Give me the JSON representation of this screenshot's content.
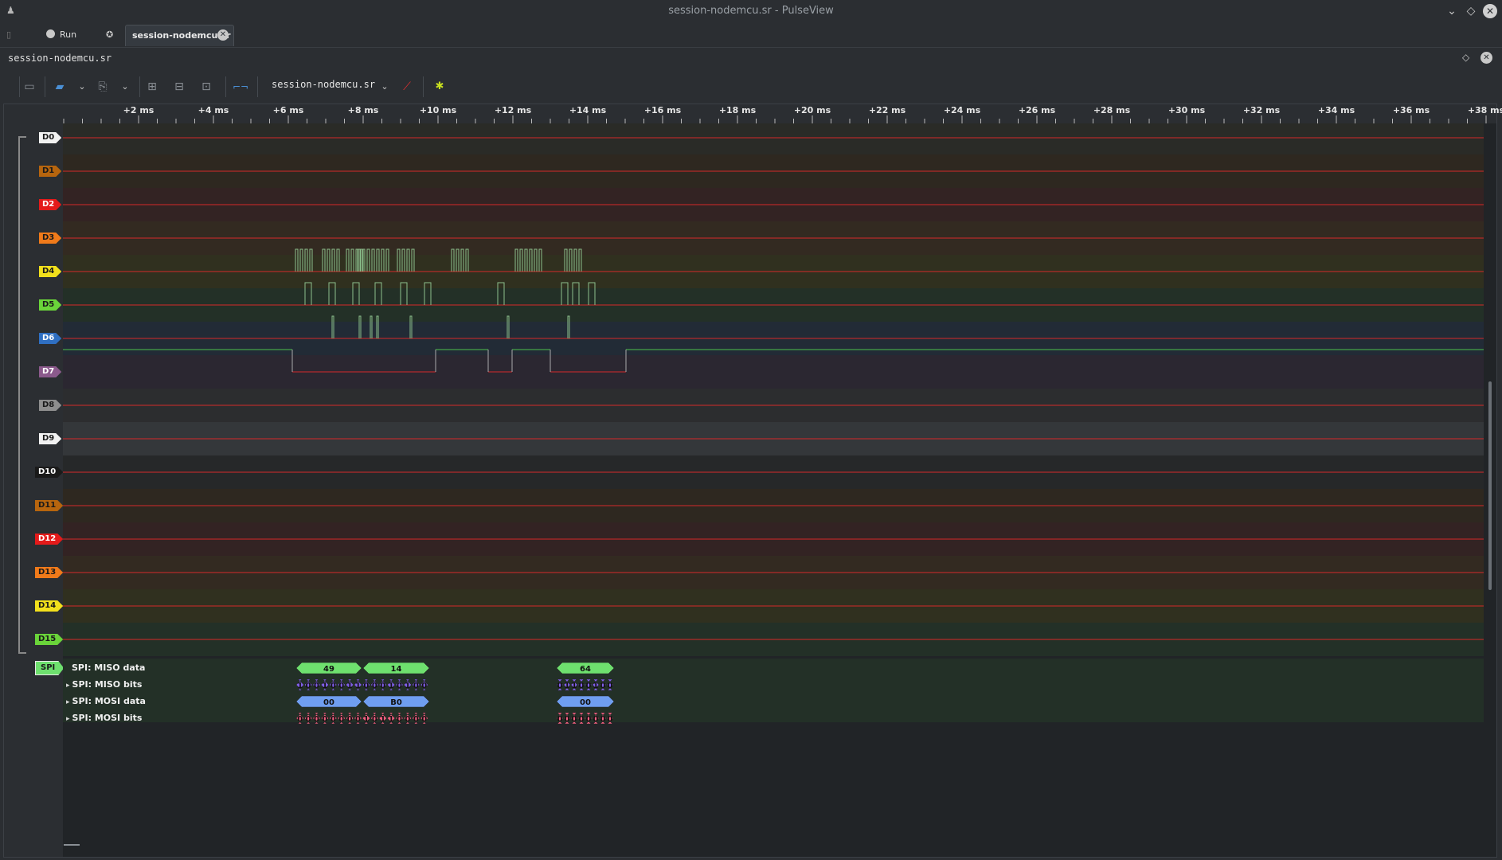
{
  "window": {
    "title": "session-nodemcu.sr - PulseView"
  },
  "tabbar": {
    "run_label": "Run",
    "tab_label": "session-nodemcu.sr"
  },
  "session": {
    "label": "session-nodemcu.sr"
  },
  "toolbar": {
    "device_label": "session-nodemcu.sr"
  },
  "ruler": {
    "ticks": [
      "+2 ms",
      "+4 ms",
      "+6 ms",
      "+8 ms",
      "+10 ms",
      "+12 ms",
      "+14 ms",
      "+16 ms",
      "+18 ms",
      "+20 ms",
      "+22 ms",
      "+24 ms",
      "+26 ms",
      "+28 ms",
      "+30 ms",
      "+32 ms",
      "+34 ms",
      "+36 ms",
      "+38 ms"
    ]
  },
  "channels": [
    {
      "name": "D0",
      "color": "#f2f2f2",
      "text": "#1a1a1a",
      "band": "#2a2b27"
    },
    {
      "name": "D1",
      "color": "#b7650e",
      "text": "#1a1a1a",
      "band": "#2e2820"
    },
    {
      "name": "D2",
      "color": "#e41a1a",
      "text": "#ffffff",
      "band": "#332323"
    },
    {
      "name": "D3",
      "color": "#f07a1a",
      "text": "#1a1a1a",
      "band": "#332a21"
    },
    {
      "name": "D4",
      "color": "#f2e01c",
      "text": "#1a1a1a",
      "band": "#30301f"
    },
    {
      "name": "D5",
      "color": "#6ad43a",
      "text": "#1a1a1a",
      "band": "#233027"
    },
    {
      "name": "D6",
      "color": "#2f6fc2",
      "text": "#ffffff",
      "band": "#222b36"
    },
    {
      "name": "D7",
      "color": "#8b5a8c",
      "text": "#ffffff",
      "band": "#2b2731"
    },
    {
      "name": "D8",
      "color": "#8e8e8e",
      "text": "#1a1a1a",
      "band": "#2c2d2f"
    },
    {
      "name": "D9",
      "color": "#f2f2f2",
      "text": "#1a1a1a",
      "band": "#34373a"
    },
    {
      "name": "D10",
      "color": "#1a1a1a",
      "text": "#ffffff",
      "band": "#262829"
    },
    {
      "name": "D11",
      "color": "#b7650e",
      "text": "#1a1a1a",
      "band": "#2e2820"
    },
    {
      "name": "D12",
      "color": "#e41a1a",
      "text": "#ffffff",
      "band": "#332323"
    },
    {
      "name": "D13",
      "color": "#f07a1a",
      "text": "#1a1a1a",
      "band": "#332a21"
    },
    {
      "name": "D14",
      "color": "#f2e01c",
      "text": "#1a1a1a",
      "band": "#30301f"
    },
    {
      "name": "D15",
      "color": "#6ad43a",
      "text": "#1a1a1a",
      "band": "#233027"
    }
  ],
  "decoder": {
    "badge": "SPI",
    "rows": [
      {
        "label": "SPI: MISO data",
        "expander": false,
        "color": "#6ee06e",
        "annotations": [
          {
            "text": "49",
            "start": 6.2,
            "end": 9.7
          },
          {
            "text": "14",
            "start": 9.8,
            "end": 13.4
          },
          {
            "text": "64",
            "start": 19.7,
            "end": 22.9
          }
        ]
      },
      {
        "label": "SPI: MISO bits",
        "expander": true,
        "color": "#8060e8",
        "bits": [
          "1",
          "0",
          "0",
          "1",
          "0",
          "0",
          "1",
          "1",
          "0",
          "0",
          "0",
          "1",
          "0",
          "1",
          "0",
          "0"
        ],
        "bits2": [
          "0",
          "1",
          "1",
          "0",
          "0",
          "1",
          "0",
          "0"
        ]
      },
      {
        "label": "SPI: MOSI data",
        "expander": true,
        "color": "#6f9ef0",
        "annotations": [
          {
            "text": "00",
            "start": 6.2,
            "end": 9.7
          },
          {
            "text": "B0",
            "start": 9.8,
            "end": 13.4
          },
          {
            "text": "00",
            "start": 19.7,
            "end": 22.9
          }
        ]
      },
      {
        "label": "SPI: MOSI bits",
        "expander": true,
        "color": "#f06080",
        "bits": [
          "0",
          "0",
          "0",
          "0",
          "0",
          "0",
          "0",
          "0",
          "1",
          "0",
          "1",
          "1",
          "0",
          "0",
          "0",
          "0"
        ],
        "bits2": [
          "0",
          "0",
          "0",
          "0",
          "0",
          "0",
          "0",
          "0"
        ]
      }
    ]
  }
}
